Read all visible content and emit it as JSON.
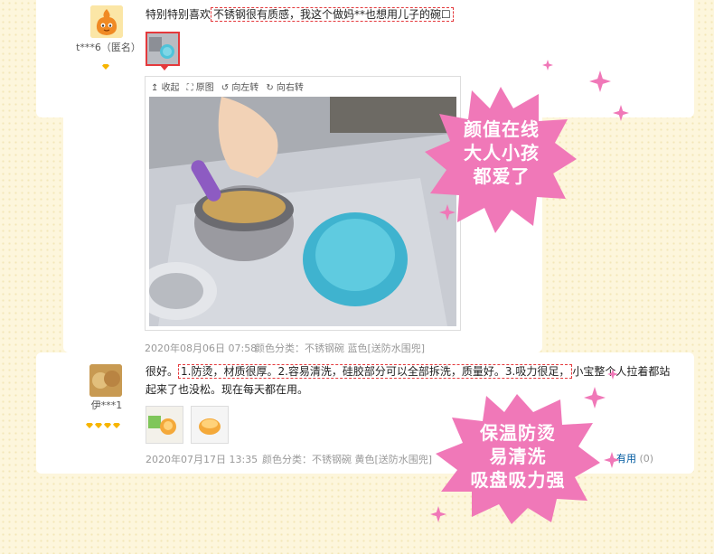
{
  "review1": {
    "user": "t***6（匿名）",
    "text_prefix": "特别特别喜欢",
    "text_highlight": "不锈钢很有质感，我这个做妈**也想用儿子的碗☐",
    "date": "2020年08月06日 07:58",
    "spec": "颜色分类：不锈钢碗 蓝色[送防水围兜]"
  },
  "viewer": {
    "collapse": "收起",
    "original": "原图",
    "rotate_left": "向左转",
    "rotate_right": "向右转"
  },
  "review2": {
    "user": "伊***1",
    "text_prefix": "很好。",
    "text_highlight": "1.防烫，材质很厚。2.容易清洗，硅胶部分可以全部拆洗，质量好。3.吸力很足，",
    "text_suffix": "小宝整个人拉着都站起来了也没松。现在每天都在用。",
    "date": "2020年07月17日 13:35",
    "spec": "颜色分类：不锈钢碗 黄色[送防水围兜]",
    "useful_label": "有用",
    "useful_count": "(0)"
  },
  "badges": {
    "top": [
      "颜值在线",
      "大人小孩",
      "都爱了"
    ],
    "bottom": [
      "保温防烫",
      "易清洗",
      "吸盘吸力强"
    ]
  },
  "colors": {
    "accent": "#e4393c",
    "badge_pink": "#f078b8",
    "link_blue": "#005aa0"
  }
}
